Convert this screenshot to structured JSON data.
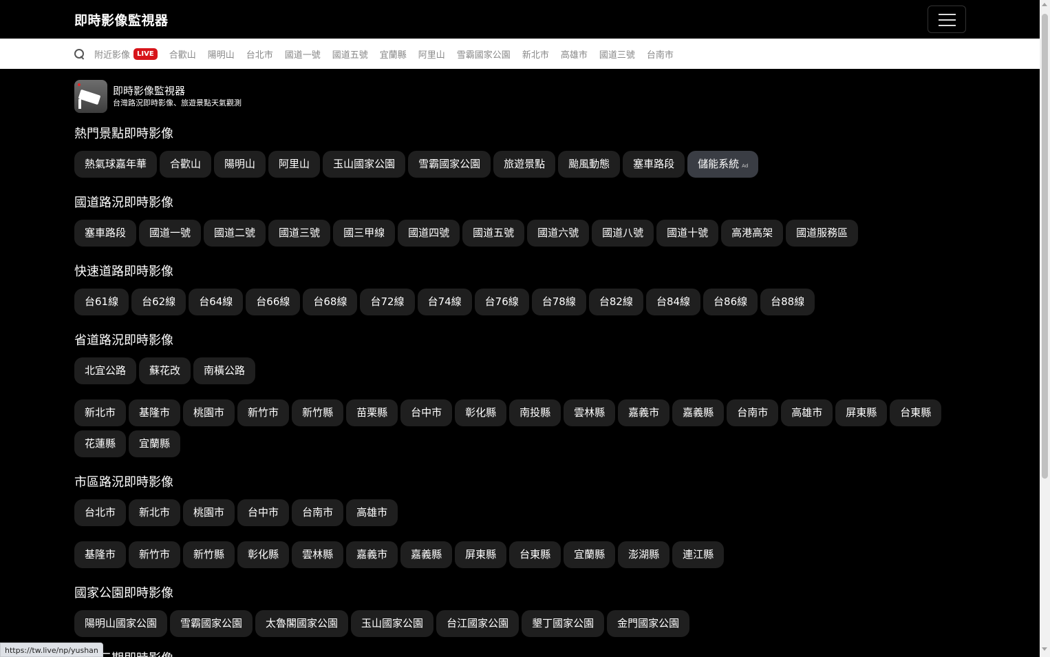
{
  "header": {
    "brand": "即時影像監視器"
  },
  "nav": {
    "live_badge": "LIVE",
    "links": [
      "附近影像",
      "合歡山",
      "陽明山",
      "台北市",
      "國道一號",
      "國道五號",
      "宜蘭縣",
      "阿里山",
      "雪霸國家公園",
      "新北市",
      "高雄市",
      "國道三號",
      "台南市"
    ]
  },
  "site": {
    "title": "即時影像監視器",
    "subtitle": "台灣路況即時影像、旅遊景點天氣觀測"
  },
  "sections": {
    "hot": {
      "title": "熱門景點即時影像",
      "chips": [
        "熱氣球嘉年華",
        "合歡山",
        "陽明山",
        "阿里山",
        "玉山國家公園",
        "雪霸國家公園",
        "旅遊景點",
        "颱風動態",
        "塞車路段"
      ],
      "ad_chip": "儲能系統",
      "ad_mark": "Ad"
    },
    "freeway": {
      "title": "國道路況即時影像",
      "chips": [
        "塞車路段",
        "國道一號",
        "國道二號",
        "國道三號",
        "國三甲線",
        "國道四號",
        "國道五號",
        "國道六號",
        "國道八號",
        "國道十號",
        "高港高架",
        "國道服務區"
      ]
    },
    "expressway": {
      "title": "快速道路即時影像",
      "chips": [
        "台61線",
        "台62線",
        "台64線",
        "台66線",
        "台68線",
        "台72線",
        "台74線",
        "台76線",
        "台78線",
        "台82線",
        "台84線",
        "台86線",
        "台88線"
      ]
    },
    "provincial": {
      "title": "省道路況即時影像",
      "chips": [
        "北宜公路",
        "蘇花改",
        "南橫公路"
      ],
      "counties": [
        "新北市",
        "基隆市",
        "桃園市",
        "新竹市",
        "新竹縣",
        "苗栗縣",
        "台中市",
        "彰化縣",
        "南投縣",
        "雲林縣",
        "嘉義市",
        "嘉義縣",
        "台南市",
        "高雄市",
        "屏東縣",
        "台東縣",
        "花蓮縣",
        "宜蘭縣"
      ]
    },
    "city": {
      "title": "市區路況即時影像",
      "chips": [
        "台北市",
        "新北市",
        "桃園市",
        "台中市",
        "台南市",
        "高雄市"
      ],
      "more": [
        "基隆市",
        "新竹市",
        "新竹縣",
        "彰化縣",
        "雲林縣",
        "嘉義市",
        "嘉義縣",
        "屏東縣",
        "台東縣",
        "宜蘭縣",
        "澎湖縣",
        "連江縣"
      ]
    },
    "national_parks": {
      "title": "國家公園即時影像",
      "chips": [
        "陽明山國家公園",
        "雪霸國家公園",
        "太魯閣國家公園",
        "玉山國家公園",
        "台江國家公園",
        "墾丁國家公園",
        "金門國家公園"
      ]
    },
    "next_partial_title": "日月三期即時影像"
  },
  "status_url": "https://tw.live/np/yushan"
}
